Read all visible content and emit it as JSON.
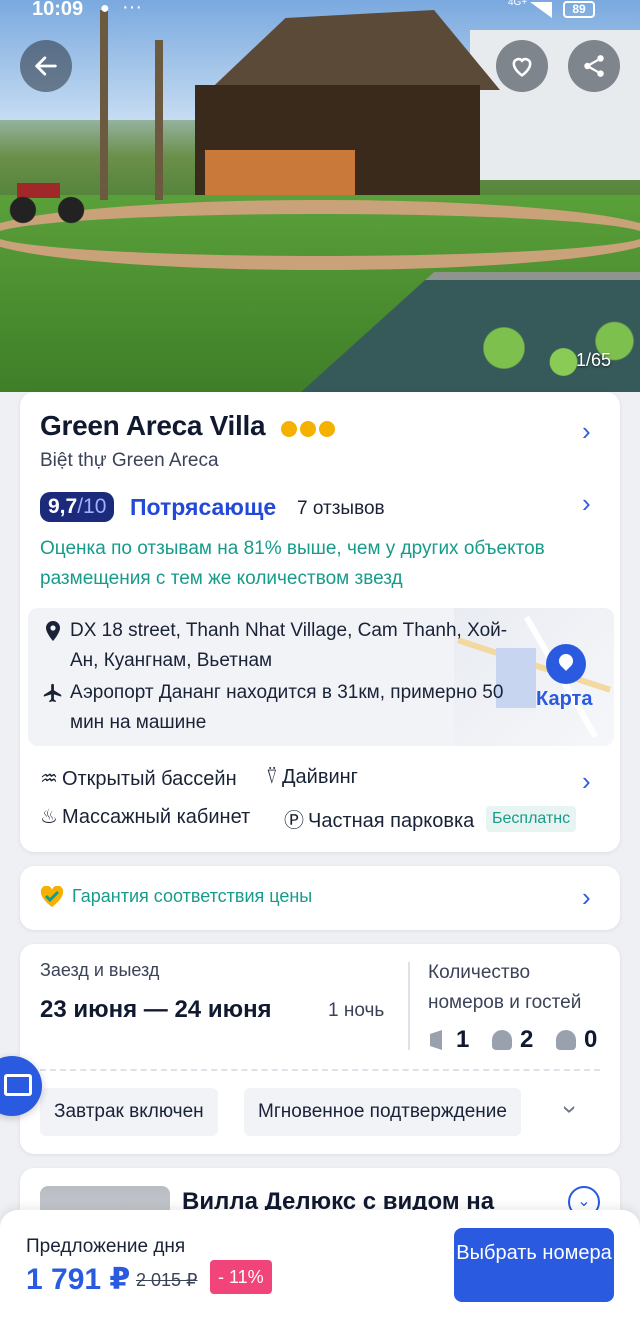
{
  "status_bar": {
    "time": "10:09",
    "network": "4G+",
    "battery": "89"
  },
  "hero": {
    "photo_counter": "1/65"
  },
  "hotel": {
    "name": "Green Areca Villa",
    "stars": 3,
    "local_name": "Biệt thự Green Areca",
    "rating_score": "9,7",
    "rating_max": "/10",
    "rating_word": "Потрясающе",
    "review_count": "7 отзывов",
    "rating_note": "Оценка по отзывам на 81% выше, чем у других объектов размещения с тем же количеством звезд",
    "address": "DX 18 street, Thanh Nhat Village, Cam Thanh, Хой-Ан, Куангнам, Вьетнам",
    "airport": "Аэропорт Дананг находится в 31км, примерно 50 мин на машине",
    "map_label": "Карта",
    "amenities": [
      {
        "label": "Открытый бассейн",
        "icon": "pool-icon"
      },
      {
        "label": "Дайвинг",
        "icon": "diving-icon"
      },
      {
        "label": "Массажный кабинет",
        "icon": "massage-icon"
      },
      {
        "label": "Частная парковка",
        "icon": "parking-icon"
      }
    ],
    "parking_tag": "Бесплатнс"
  },
  "guarantee": {
    "label": "Гарантия соответствия цены"
  },
  "booking": {
    "dates_label": "Заезд и выезд",
    "dates": "23 июня — 24 июня",
    "nights": "1 ночь",
    "guests_label": "Количество номеров и гостей",
    "rooms": "1",
    "adults": "2",
    "children": "0",
    "chips": [
      "Завтрак включен",
      "Мгновенное подтверждение"
    ]
  },
  "room": {
    "title": "Вилла Делюкс с видом на"
  },
  "bottom": {
    "deal_label": "Предложение дня",
    "price": "1 791 ₽",
    "old_price": "2 015 ₽",
    "discount": "- 11%",
    "button": "Выбрать номера"
  },
  "colors": {
    "accent": "#2a5ae0",
    "rating_badge": "#1b2a7a",
    "teal": "#179b8a",
    "discount": "#f0447a",
    "stars": "#f5b100"
  }
}
